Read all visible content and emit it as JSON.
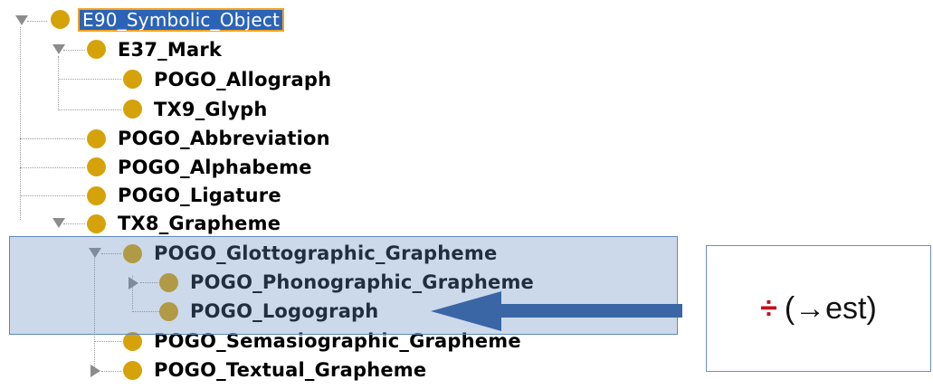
{
  "tree": {
    "root": {
      "label": "E90_Symbolic_Object"
    },
    "items": [
      {
        "label": "E37_Mark"
      },
      {
        "label": "POGO_Allograph"
      },
      {
        "label": "TX9_Glyph"
      },
      {
        "label": "POGO_Abbreviation"
      },
      {
        "label": "POGO_Alphabeme"
      },
      {
        "label": "POGO_Ligature"
      },
      {
        "label": "TX8_Grapheme"
      },
      {
        "label": "POGO_Glottographic_Grapheme"
      },
      {
        "label": "POGO_Phonographic_Grapheme"
      },
      {
        "label": "POGO_Logograph"
      },
      {
        "label": "POGO_Semasiographic_Grapheme"
      },
      {
        "label": "POGO_Textual_Grapheme"
      }
    ]
  },
  "callout": {
    "symbol": "÷",
    "text": "(→est)"
  },
  "colors": {
    "class_dot": "#d6a20a",
    "selection_bg": "#2b63b8",
    "selection_border": "#f4a31c",
    "highlight": "#648cbe",
    "arrow": "#3a66a6",
    "symbol": "#c0101c"
  }
}
